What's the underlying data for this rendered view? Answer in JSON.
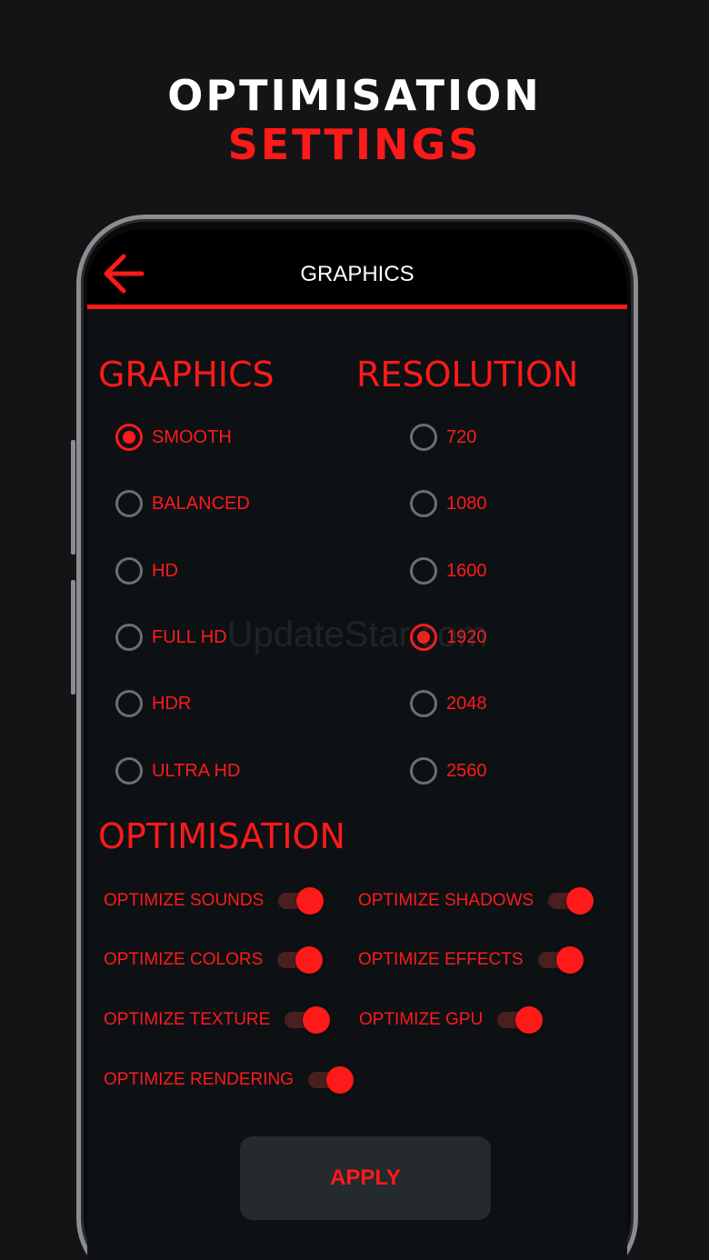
{
  "promo": {
    "line1": "OPTIMISATION",
    "line2": "SETTINGS"
  },
  "appbar": {
    "title": "GRAPHICS",
    "back_icon": "arrow-left-icon"
  },
  "graphics": {
    "title": "GRAPHICS",
    "options": [
      {
        "label": "SMOOTH",
        "selected": true
      },
      {
        "label": "BALANCED",
        "selected": false
      },
      {
        "label": "HD",
        "selected": false
      },
      {
        "label": "FULL HD",
        "selected": false
      },
      {
        "label": "HDR",
        "selected": false
      },
      {
        "label": "ULTRA HD",
        "selected": false
      }
    ]
  },
  "resolution": {
    "title": "RESOLUTION",
    "options": [
      {
        "label": "720",
        "selected": false
      },
      {
        "label": "1080",
        "selected": false
      },
      {
        "label": "1600",
        "selected": false
      },
      {
        "label": "1920",
        "selected": true
      },
      {
        "label": "2048",
        "selected": false
      },
      {
        "label": "2560",
        "selected": false
      }
    ]
  },
  "optimisation": {
    "title": "OPTIMISATION",
    "toggles": [
      {
        "label": "OPTIMIZE SOUNDS",
        "on": true
      },
      {
        "label": "OPTIMIZE SHADOWS",
        "on": true
      },
      {
        "label": "OPTIMIZE COLORS",
        "on": true
      },
      {
        "label": "OPTIMIZE EFFECTS",
        "on": true
      },
      {
        "label": "OPTIMIZE TEXTURE",
        "on": true
      },
      {
        "label": "OPTIMIZE GPU",
        "on": true
      },
      {
        "label": "OPTIMIZE RENDERING",
        "on": true
      }
    ]
  },
  "apply_label": "APPLY",
  "watermark": "UpdateStar.com",
  "colors": {
    "accent": "#ff1a1a",
    "screen_bg": "#0d1114",
    "appbar_bg": "#000000",
    "button_bg": "#252a2c"
  }
}
